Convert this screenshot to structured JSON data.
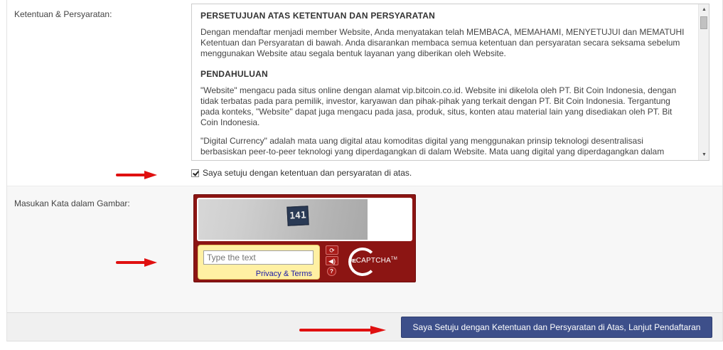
{
  "terms_section": {
    "label": "Ketentuan & Persyaratan:",
    "heading_1": "PERSETUJUAN ATAS KETENTUAN DAN PERSYARATAN",
    "paragraph_1": "Dengan mendaftar menjadi member Website, Anda menyatakan telah MEMBACA, MEMAHAMI, MENYETUJUI dan MEMATUHI Ketentuan dan Persyaratan di bawah. Anda disarankan membaca semua ketentuan dan persyaratan secara seksama sebelum menggunakan Website atau segala bentuk layanan yang diberikan oleh Website.",
    "heading_2": "PENDAHULUAN",
    "paragraph_2": "\"Website\" mengacu pada situs online dengan alamat vip.bitcoin.co.id. Website ini dikelola oleh PT. Bit Coin Indonesia, dengan tidak terbatas pada para pemilik, investor, karyawan dan pihak-pihak yang terkait dengan PT. Bit Coin Indonesia. Tergantung pada konteks, \"Website\" dapat juga mengacu pada jasa, produk, situs, konten atau material lain yang disediakan oleh PT. Bit Coin Indonesia.",
    "paragraph_3": "\"Digital Currency\" adalah mata uang digital atau komoditas digital yang menggunakan prinsip teknologi desentralisasi berbasiskan peer-to-peer teknologi yang diperdagangkan di dalam Website. Mata uang digital yang diperdagangkan dalam",
    "agree_label": "Saya setuju dengan ketentuan dan persyaratan di atas.",
    "agree_checked": true
  },
  "captcha_section": {
    "label": "Masukan Kata dalam Gambar:",
    "captcha_image_text": "141",
    "input_placeholder": "Type the text",
    "privacy_link": "Privacy & Terms",
    "refresh_icon": "refresh-icon",
    "audio_icon": "speaker-icon",
    "help_icon": "help-icon",
    "logo_re": "RE",
    "logo_text": "CAPTCHA",
    "logo_tm": "TM"
  },
  "footer": {
    "submit_label": "Saya Setuju dengan Ketentuan dan Persyaratan di Atas, Lanjut Pendaftaran"
  },
  "colors": {
    "arrow": "#e01010",
    "submit_bg": "#3d4f8a",
    "recaptcha_bg": "#8c1513"
  }
}
